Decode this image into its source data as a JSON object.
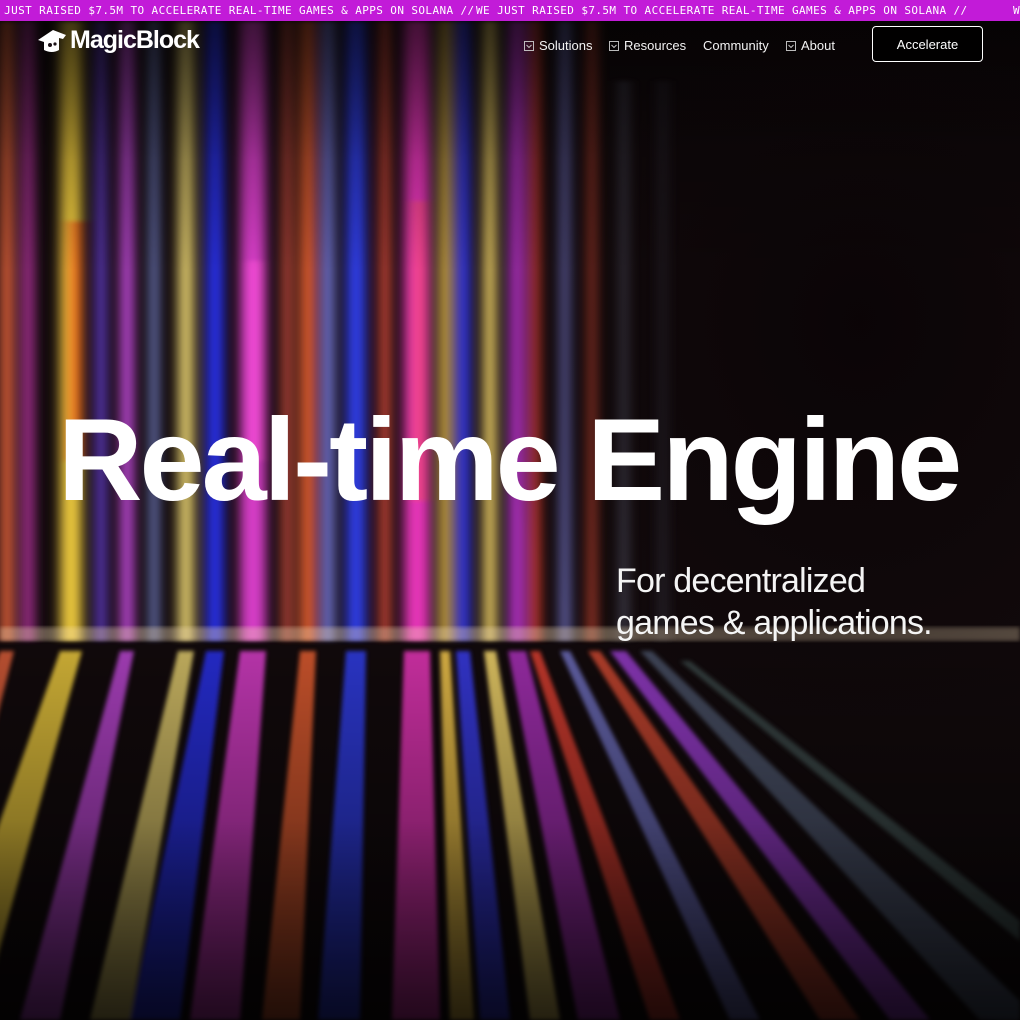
{
  "announcement": {
    "text": "WE JUST RAISED $7.5M TO ACCELERATE REAL-TIME GAMES & APPS ON SOLANA //",
    "color": "#c21bd8"
  },
  "brand": {
    "name": "MagicBlock",
    "logo_icon": "wizard-hat-icon"
  },
  "nav": {
    "items": [
      {
        "label": "Solutions",
        "icon": "chevron-down-box-icon"
      },
      {
        "label": "Resources",
        "icon": "chevron-down-box-icon"
      },
      {
        "label": "Community"
      },
      {
        "label": "About",
        "icon": "chevron-down-box-icon"
      }
    ],
    "cta_label": "Accelerate"
  },
  "hero": {
    "headline": "Real-time Engine",
    "subhead_line1": "For decentralized",
    "subhead_line2": "games & applications."
  }
}
